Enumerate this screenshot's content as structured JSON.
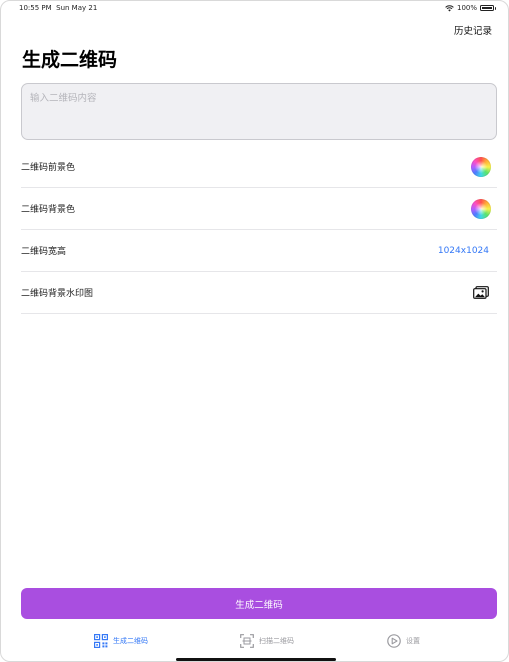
{
  "status_bar": {
    "time": "10:55 PM",
    "date": "Sun May 21",
    "battery": "100%"
  },
  "nav": {
    "history_label": "历史记录"
  },
  "page": {
    "title": "生成二维码"
  },
  "input": {
    "placeholder": "输入二维码内容",
    "value": ""
  },
  "settings": {
    "rows": [
      {
        "label": "二维码前景色",
        "control": "color-wheel-icon"
      },
      {
        "label": "二维码背景色",
        "control": "color-wheel-icon"
      },
      {
        "label": "二维码宽高",
        "value": "1024x1024"
      },
      {
        "label": "二维码背景水印图",
        "control": "photo-icon"
      }
    ]
  },
  "actions": {
    "generate_label": "生成二维码"
  },
  "tabs": [
    {
      "label": "生成二维码",
      "icon": "qrcode-icon",
      "active": true
    },
    {
      "label": "扫描二维码",
      "icon": "scan-icon",
      "active": false
    },
    {
      "label": "设置",
      "icon": "settings-icon",
      "active": false
    }
  ],
  "colors": {
    "accent": "#a94ee0",
    "link": "#3478f6",
    "inactive_tab": "#9a9a9f"
  }
}
